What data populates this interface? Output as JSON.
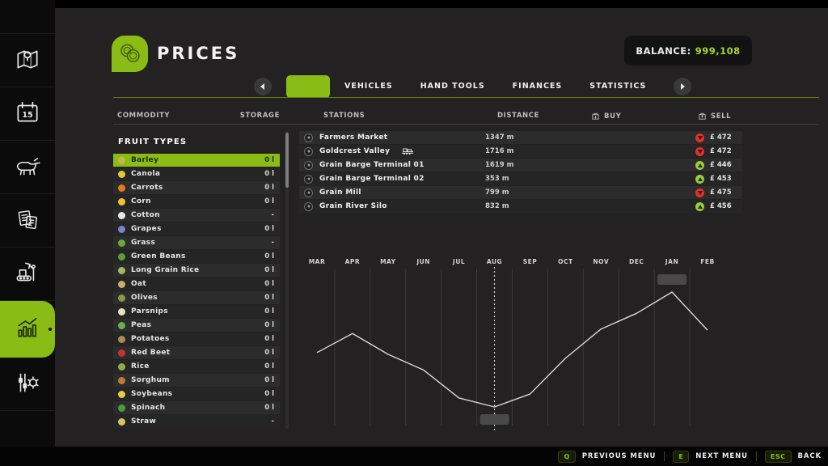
{
  "colors": {
    "accent_green": "#8abc16",
    "balance_value": "#a7d435",
    "trend_up": "#9ccb3b",
    "trend_down": "#dd3327",
    "chart_line": "#d9d9d9"
  },
  "header": {
    "title": "PRICES"
  },
  "balance": {
    "label": "BALANCE:",
    "value": "999,108"
  },
  "tabs": {
    "active_label": "",
    "items": [
      "VEHICLES",
      "HAND TOOLS",
      "FINANCES",
      "STATISTICS"
    ]
  },
  "table_headers": {
    "commodity": "COMMODITY",
    "storage": "STORAGE",
    "stations": "STATIONS",
    "distance": "DISTANCE",
    "buy": "BUY",
    "sell": "SELL"
  },
  "commodities": {
    "title": "FRUIT TYPES",
    "selected": "Barley",
    "items": [
      {
        "name": "Barley",
        "storage": "0 l",
        "icon": "barley-icon",
        "color": "#cdb24a",
        "selected": true
      },
      {
        "name": "Canola",
        "storage": "0 l",
        "icon": "canola-icon",
        "color": "#e0c83c"
      },
      {
        "name": "Carrots",
        "storage": "0 l",
        "icon": "carrot-icon",
        "color": "#e07a1f"
      },
      {
        "name": "Corn",
        "storage": "0 l",
        "icon": "corn-icon",
        "color": "#edc52c"
      },
      {
        "name": "Cotton",
        "storage": "-",
        "icon": "cotton-icon",
        "color": "#e9e9e9"
      },
      {
        "name": "Grapes",
        "storage": "0 l",
        "icon": "grapes-icon",
        "color": "#7b85c4"
      },
      {
        "name": "Grass",
        "storage": "-",
        "icon": "grass-icon",
        "color": "#6faa3d"
      },
      {
        "name": "Green Beans",
        "storage": "0 l",
        "icon": "green-beans-icon",
        "color": "#5a9e3a"
      },
      {
        "name": "Long Grain Rice",
        "storage": "0 l",
        "icon": "long-grain-rice-icon",
        "color": "#a4b860"
      },
      {
        "name": "Oat",
        "storage": "0 l",
        "icon": "oat-icon",
        "color": "#c9b06b"
      },
      {
        "name": "Olives",
        "storage": "0 l",
        "icon": "olives-icon",
        "color": "#8a9a3a"
      },
      {
        "name": "Parsnips",
        "storage": "0 l",
        "icon": "parsnip-icon",
        "color": "#e9e0bd"
      },
      {
        "name": "Peas",
        "storage": "0 l",
        "icon": "peas-icon",
        "color": "#6ab04a"
      },
      {
        "name": "Potatoes",
        "storage": "0 l",
        "icon": "potato-icon",
        "color": "#b08a5a"
      },
      {
        "name": "Red Beet",
        "storage": "0 l",
        "icon": "red-beet-icon",
        "color": "#c23434"
      },
      {
        "name": "Rice",
        "storage": "0 l",
        "icon": "rice-icon",
        "color": "#8fae4e"
      },
      {
        "name": "Sorghum",
        "storage": "0 l",
        "icon": "sorghum-icon",
        "color": "#c27a38"
      },
      {
        "name": "Soybeans",
        "storage": "0 l",
        "icon": "soybeans-icon",
        "color": "#e5c94a"
      },
      {
        "name": "Spinach",
        "storage": "0 l",
        "icon": "spinach-icon",
        "color": "#4a9e3a"
      },
      {
        "name": "Straw",
        "storage": "-",
        "icon": "straw-icon",
        "color": "#d9c261"
      }
    ]
  },
  "stations": {
    "rows": [
      {
        "name": "Farmers Market",
        "distance": "1347 m",
        "trend": "down",
        "price": "£ 472",
        "train": false
      },
      {
        "name": "Goldcrest Valley",
        "distance": "1716 m",
        "trend": "down",
        "price": "£ 472",
        "train": true
      },
      {
        "name": "Grain Barge Terminal 01",
        "distance": "1619 m",
        "trend": "up",
        "price": "£ 446",
        "train": false
      },
      {
        "name": "Grain Barge Terminal 02",
        "distance": "353 m",
        "trend": "up",
        "price": "£ 453",
        "train": false
      },
      {
        "name": "Grain Mill",
        "distance": "799 m",
        "trend": "down",
        "price": "£ 475",
        "train": false
      },
      {
        "name": "Grain River Silo",
        "distance": "832 m",
        "trend": "up",
        "price": "£ 456",
        "train": false
      }
    ]
  },
  "chart_data": {
    "type": "line",
    "title": "Barley sell price by month",
    "x_labels": [
      "MAR",
      "APR",
      "MAY",
      "JUN",
      "JUL",
      "AUG",
      "SEP",
      "OCT",
      "NOV",
      "DEC",
      "JAN",
      "FEB"
    ],
    "values": [
      522,
      556,
      519,
      491,
      441,
      425,
      448,
      512,
      564,
      592,
      630,
      562
    ],
    "unit": "£",
    "cursor_month": "AUG",
    "min_month": "AUG",
    "max_month": "JAN",
    "grid": "vertical-only",
    "legend": "none"
  },
  "sidebar": {
    "calendar_day": "15",
    "items": [
      {
        "icon": "map-icon",
        "active": false
      },
      {
        "icon": "calendar-icon",
        "active": false
      },
      {
        "icon": "animals-icon",
        "active": false
      },
      {
        "icon": "contracts-icon",
        "active": false
      },
      {
        "icon": "production-icon",
        "active": false
      },
      {
        "icon": "statistics-icon",
        "active": true
      },
      {
        "icon": "settings-icon",
        "active": false
      }
    ]
  },
  "footer": {
    "hints": [
      {
        "key": "Q",
        "label": "PREVIOUS MENU"
      },
      {
        "key": "E",
        "label": "NEXT MENU"
      },
      {
        "key": "ESC",
        "label": "BACK"
      }
    ]
  }
}
